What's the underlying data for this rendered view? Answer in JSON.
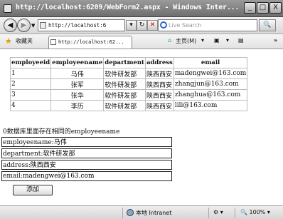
{
  "window": {
    "title": "http://localhost:6209/WebForm2.aspx - Windows Inter...",
    "min_label": "_",
    "max_label": "□",
    "close_label": "X"
  },
  "nav": {
    "back_icon": "◀",
    "forward_icon": "▶",
    "address": "http://localhost:6",
    "refresh_icon": "↻",
    "stop_icon": "✕",
    "search_placeholder": "Live Search",
    "search_icon": "🔍"
  },
  "commandbar": {
    "favorites_label": "收藏夹",
    "tab_title": "http://localhost:62...",
    "home_label": "主页(M)",
    "extra": "»"
  },
  "table": {
    "headers": [
      "employeeid",
      "employeename",
      "department",
      "address",
      "email"
    ],
    "rows": [
      [
        "1",
        "马伟",
        "软件研发部",
        "陕西西安",
        "madengwei@163.com"
      ],
      [
        "2",
        "张军",
        "软件研发部",
        "陕西西安",
        "zhangjun@163.com"
      ],
      [
        "3",
        "张华",
        "软件研发部",
        "陕西西安",
        "zhanghua@163.com"
      ],
      [
        "4",
        "李历",
        "软件研发部",
        "陕西西安",
        "lili@163.com"
      ]
    ]
  },
  "form": {
    "message": "0数据库里面存在相同的employeename",
    "employeename_label": "employeename:",
    "employeename_value": "马伟",
    "department_label": "department:",
    "department_value": "软件研发部",
    "address_label": "address:",
    "address_value": "陕西西安",
    "email_label": "email:",
    "email_value": "madengwei@163.com",
    "add_button": "添加"
  },
  "status": {
    "zone": "本地 Intranet",
    "zoom": "100%"
  }
}
